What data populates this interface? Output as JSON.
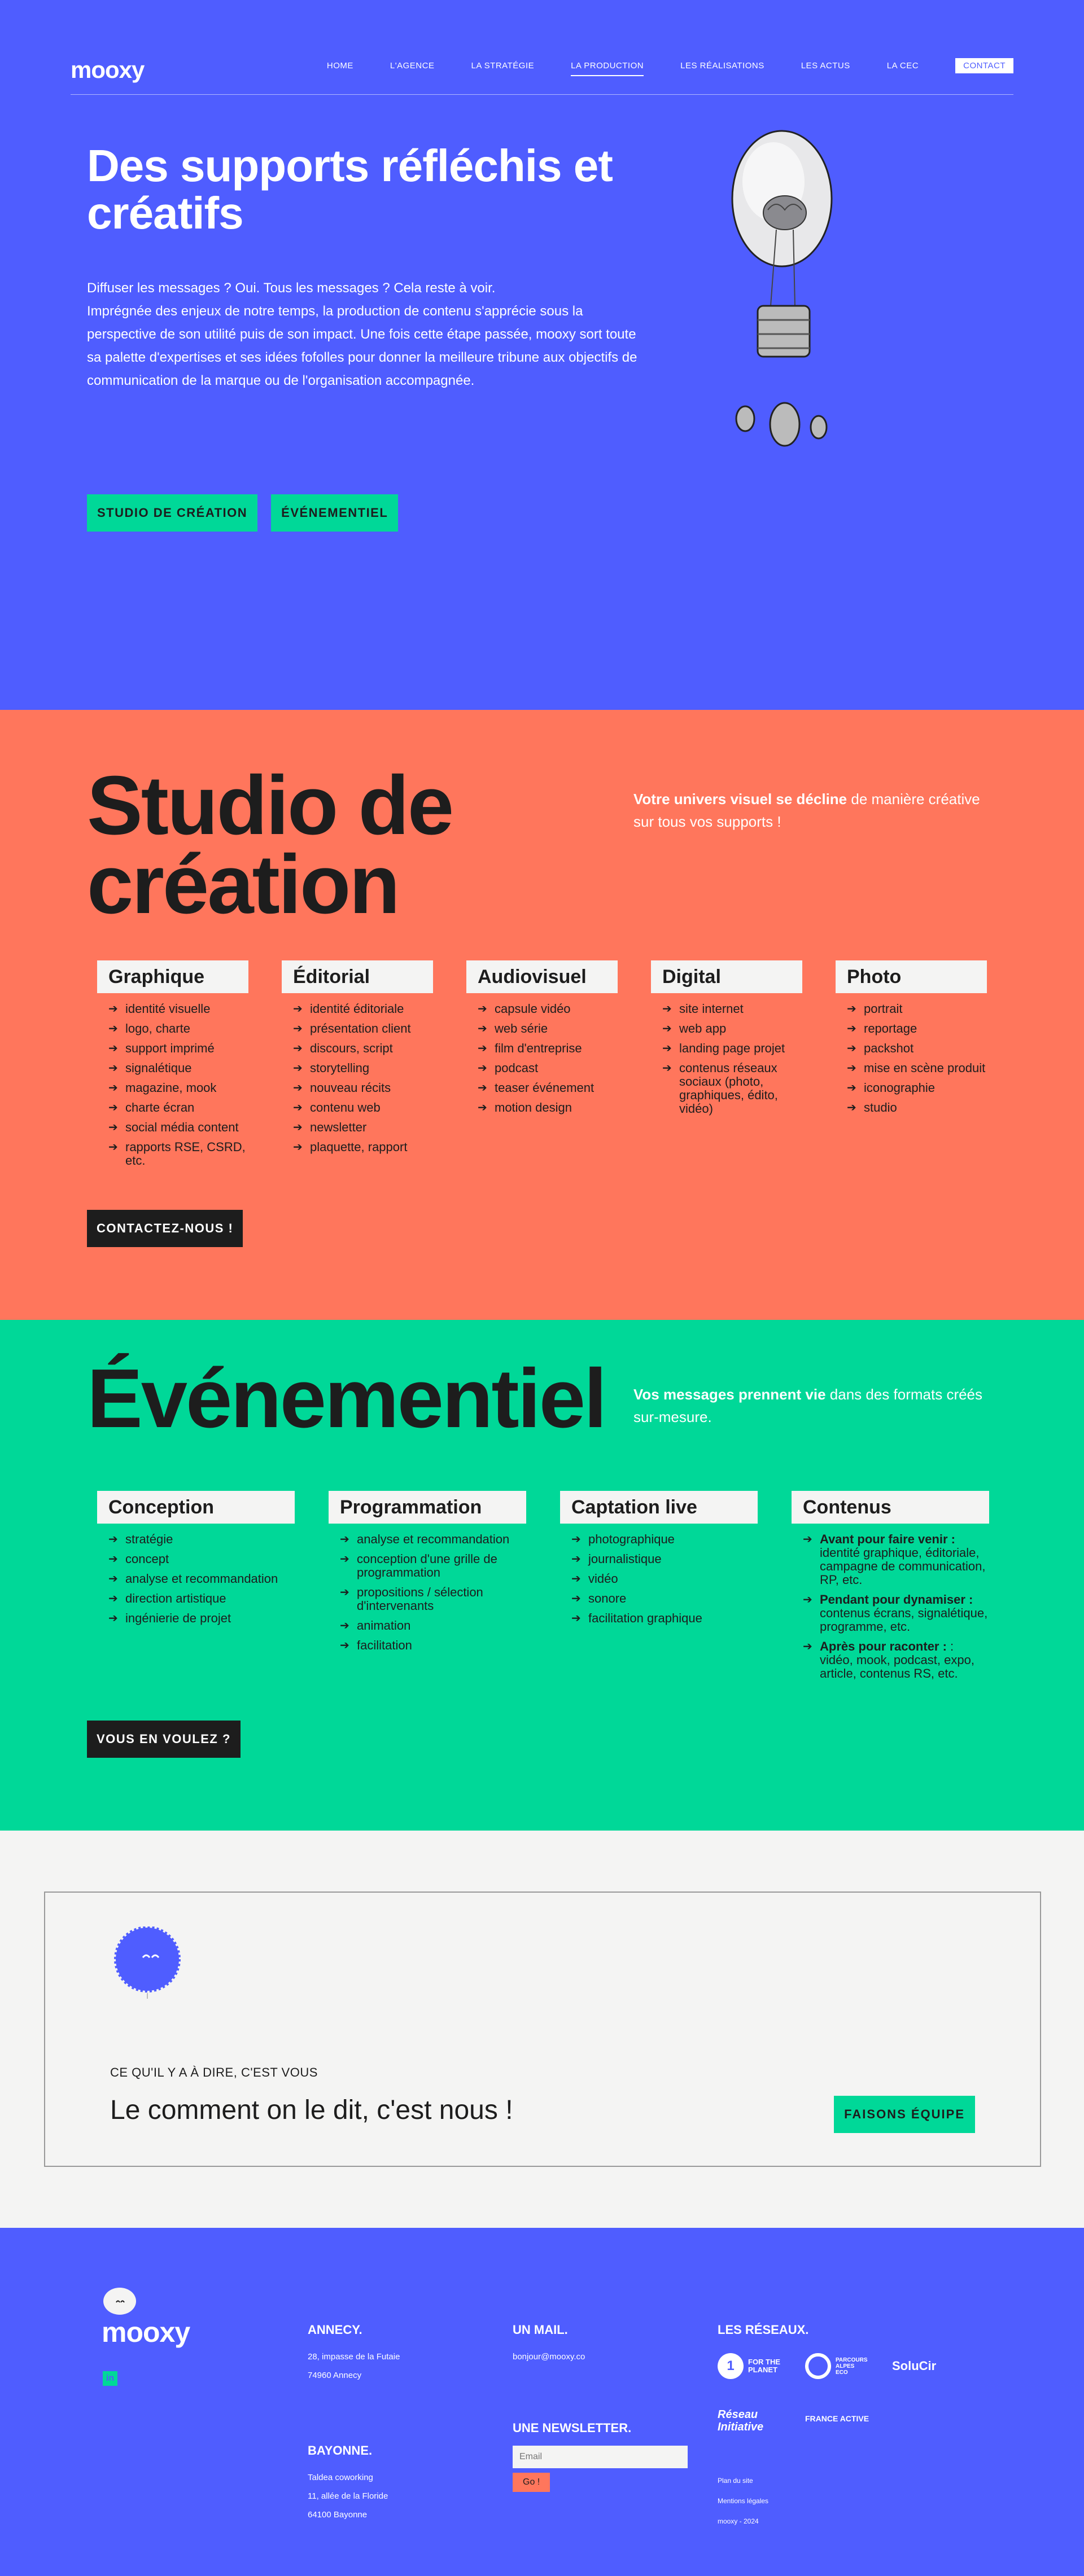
{
  "nav": {
    "logo": "mooxy",
    "items": [
      "HOME",
      "L'AGENCE",
      "LA STRATÉGIE",
      "LA PRODUCTION",
      "LES RÉALISATIONS",
      "LES ACTUS",
      "LA CEC"
    ],
    "active": "LA PRODUCTION",
    "contact": "CONTACT"
  },
  "hero": {
    "title": "Des supports réfléchis et créatifs",
    "intro_l1": "Diffuser les messages ? Oui. Tous les messages ? Cela reste à voir.",
    "intro_l2": "Imprégnée des enjeux de notre temps, la production de contenu s'apprécie sous la perspective de son utilité puis de son impact. Une fois cette étape passée, mooxy sort toute sa palette d'expertises et ses idées fofolles pour donner la meilleure tribune aux objectifs de communication de la marque ou de l'organisation accompagnée.",
    "btn1": "STUDIO DE CRÉATION",
    "btn2": "ÉVÉNEMENTIEL"
  },
  "studio": {
    "title": "Studio de création",
    "side_bold": "Votre univers visuel se décline",
    "side_rest": " de manière créative sur tous vos supports !",
    "cols": [
      {
        "title": "Graphique",
        "items": [
          "identité visuelle",
          "logo, charte",
          "support imprimé",
          "signalétique",
          "magazine, mook",
          "charte écran",
          "social média content",
          "rapports RSE, CSRD, etc."
        ]
      },
      {
        "title": "Éditorial",
        "items": [
          "identité éditoriale",
          "présentation client",
          "discours, script",
          "storytelling",
          "nouveau récits",
          "contenu web",
          "newsletter",
          "plaquette, rapport"
        ]
      },
      {
        "title": "Audiovisuel",
        "items": [
          "capsule vidéo",
          "web série",
          "film d'entreprise",
          "podcast",
          "teaser événement",
          "motion design"
        ]
      },
      {
        "title": "Digital",
        "items": [
          "site internet",
          "web app",
          "landing page projet",
          "contenus réseaux sociaux (photo, graphiques, édito, vidéo)"
        ]
      },
      {
        "title": "Photo",
        "items": [
          "portrait",
          "reportage",
          "packshot",
          "mise en scène produit",
          "iconographie",
          "studio"
        ]
      }
    ],
    "cta": "CONTACTEZ-NOUS !"
  },
  "evt": {
    "title": "Événementiel",
    "side_bold": "Vos messages prennent vie",
    "side_rest": " dans des formats créés sur-mesure.",
    "cols": [
      {
        "title": "Conception",
        "items": [
          "stratégie",
          "concept",
          "analyse et recommandation",
          "direction artistique",
          "ingénierie de projet"
        ]
      },
      {
        "title": "Programmation",
        "items": [
          "analyse et recommandation",
          "conception d'une grille de programmation",
          "propositions / sélection d'intervenants",
          "animation",
          "facilitation"
        ]
      },
      {
        "title": "Captation live",
        "items": [
          "photographique",
          "journalistique",
          "vidéo",
          "sonore",
          "facilitation graphique"
        ]
      },
      {
        "title": "Contenus",
        "rich": [
          {
            "b": "Avant pour faire venir :",
            "t": " identité graphique, éditoriale, campagne de communication, RP, etc."
          },
          {
            "b": "Pendant pour dynamiser :",
            "t": " contenus écrans, signalétique, programme, etc."
          },
          {
            "b": "Après pour raconter :",
            "t": " : vidéo, mook, podcast, expo, article, contenus RS, etc."
          }
        ]
      }
    ],
    "cta": "VOUS EN VOULEZ ?"
  },
  "quote": {
    "kicker": "CE QU'IL Y A À DIRE, C'EST VOUS",
    "title": "Le comment on le dit, c'est nous !",
    "cta": "FAISONS ÉQUIPE"
  },
  "footer": {
    "logo": "mooxy",
    "annecy_h": "ANNECY.",
    "annecy_1": "28, impasse de la Futaie",
    "annecy_2": "74960 Annecy",
    "bayonne_h": "BAYONNE.",
    "bayonne_1": "Taldea coworking",
    "bayonne_2": "11, allée de la Floride",
    "bayonne_3": "64100 Bayonne",
    "mail_h": "UN MAIL.",
    "mail": "bonjour@mooxy.co",
    "news_h": "UNE NEWSLETTER.",
    "news_placeholder": "Email",
    "news_btn": "Go !",
    "res_h": "LES RÉSEAUX.",
    "partners": [
      "FOR THE PLANET",
      "PARCOURS ALPES ECO",
      "SoluCir",
      "Réseau Initiative",
      "FRANCE ACTIVE"
    ],
    "links": [
      "Plan du site",
      "Mentions légales",
      "mooxy - 2024"
    ]
  },
  "colors": {
    "blue": "#4f5dff",
    "coral": "#ff765c",
    "green": "#00d898",
    "dark": "#1d1d1d",
    "light": "#f4f4f3"
  }
}
